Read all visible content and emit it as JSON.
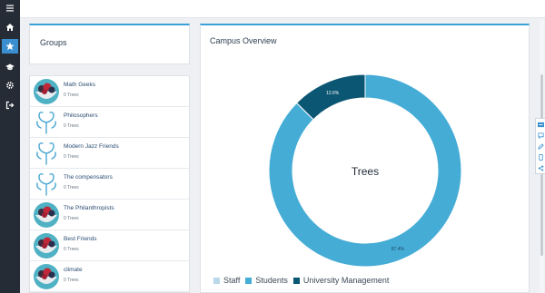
{
  "nav": {
    "items": [
      {
        "icon": "menu-icon"
      },
      {
        "icon": "home-icon"
      },
      {
        "icon": "star-icon",
        "active": true
      },
      {
        "icon": "graduation-cap-icon"
      },
      {
        "icon": "gear-icon"
      },
      {
        "icon": "logout-icon"
      }
    ]
  },
  "groups": {
    "title": "Groups",
    "items": [
      {
        "name": "Math Geeks",
        "count": "0 Trees",
        "avatar": "fruit-bowl-avatar"
      },
      {
        "name": "Philosophers",
        "count": "0 Trees",
        "avatar": "blue-tree-avatar"
      },
      {
        "name": "Modern Jazz Friends",
        "count": "0 Trees",
        "avatar": "blue-tree-avatar"
      },
      {
        "name": "The compensators",
        "count": "0 Trees",
        "avatar": "blue-tree-avatar"
      },
      {
        "name": "The Philanthropists",
        "count": "0 Trees",
        "avatar": "fruit-bowl-avatar"
      },
      {
        "name": "Best Friends",
        "count": "0 Trees",
        "avatar": "fruit-bowl-avatar"
      },
      {
        "name": "climate",
        "count": "0 Trees",
        "avatar": "fruit-bowl-avatar"
      }
    ]
  },
  "campus": {
    "title": "Campus Overview",
    "center_label": "Trees",
    "slices": [
      {
        "name": "Staff",
        "percent": 0.0,
        "label": "",
        "color": "#b9d8ea"
      },
      {
        "name": "Students",
        "percent": 87.4,
        "label": "87.4%",
        "color": "#45acd6"
      },
      {
        "name": "University Management",
        "percent": 12.6,
        "label": "12.6%",
        "color": "#0b5673"
      }
    ]
  },
  "right_tools": [
    "translate-icon",
    "chat-icon",
    "edit-icon",
    "mobile-icon",
    "share-icon"
  ],
  "colors": {
    "accent": "#3ba1d8",
    "sidebar": "#262c36",
    "active": "#3a8fd0"
  }
}
